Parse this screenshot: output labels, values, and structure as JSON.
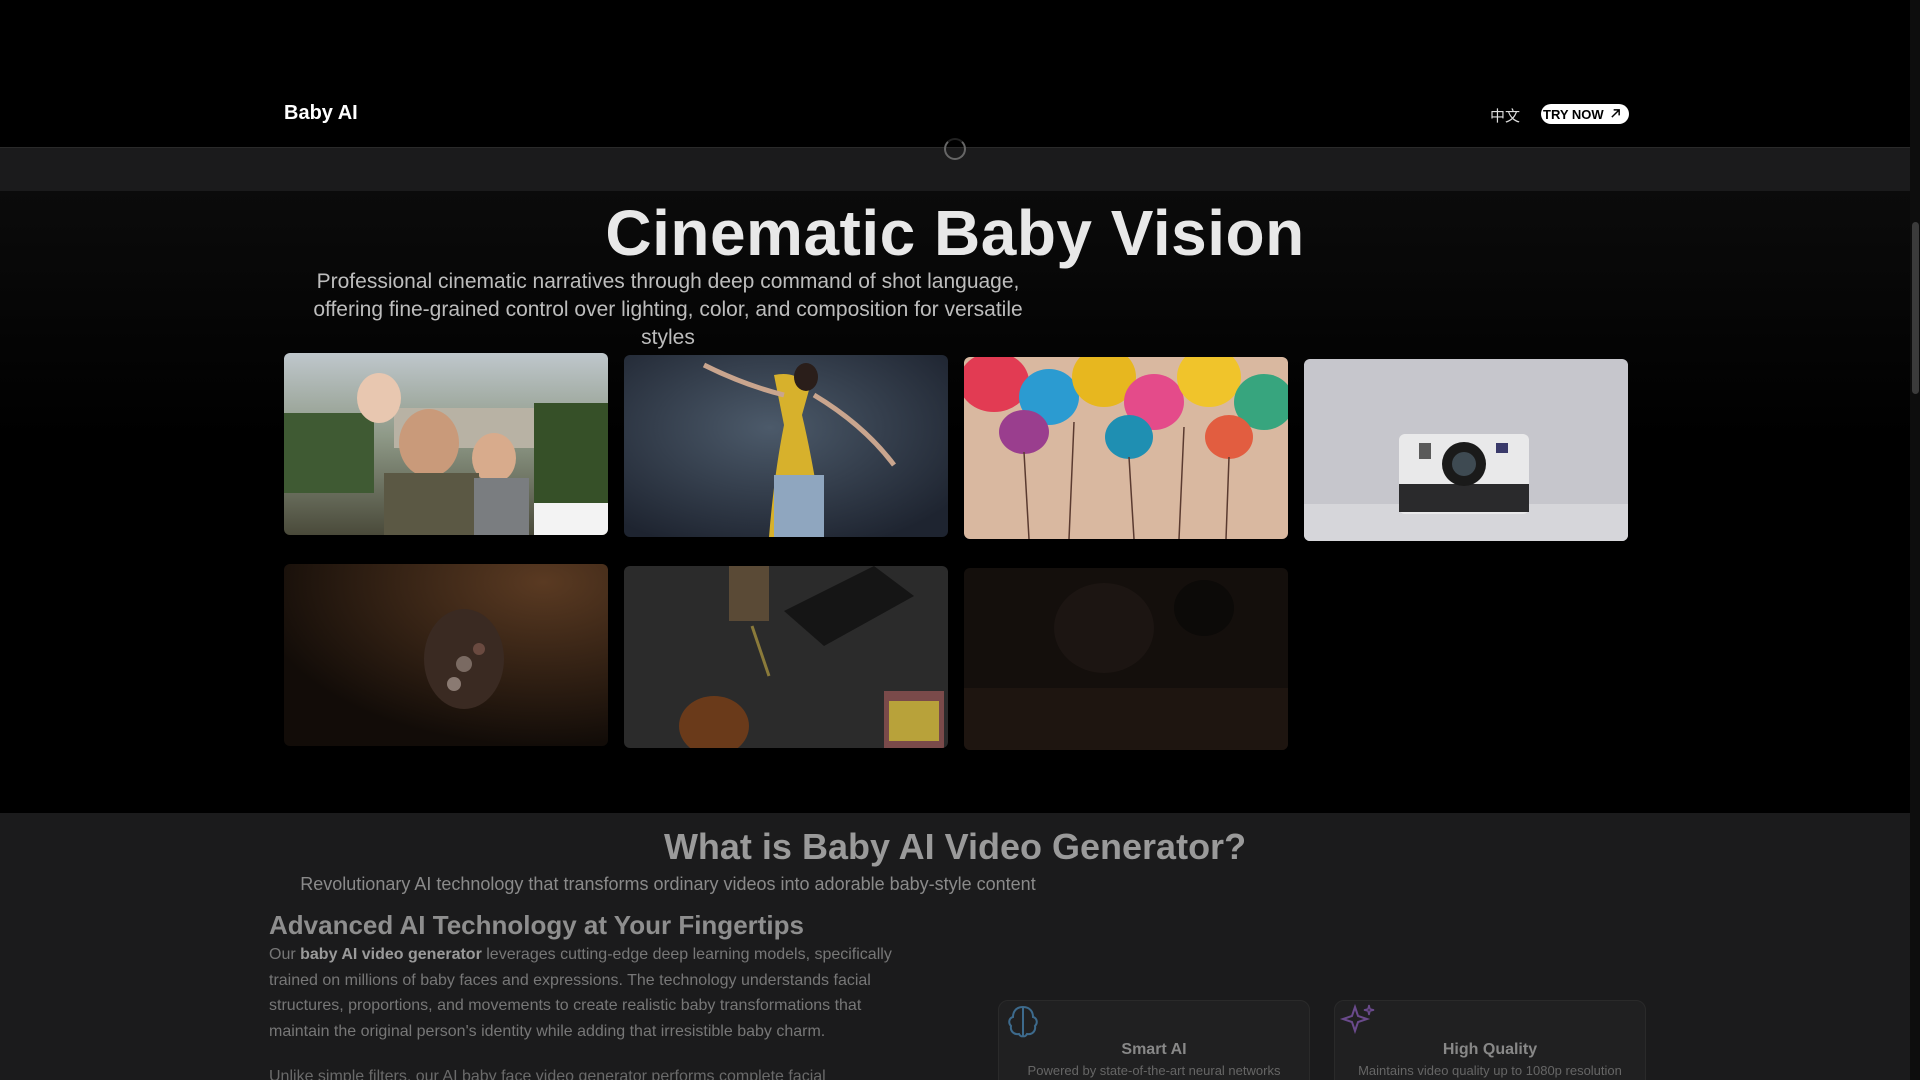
{
  "header": {
    "logo": "Baby AI",
    "lang_switch": "中文",
    "try_button": "TRY NOW"
  },
  "hero": {
    "title": "Cinematic Baby Vision",
    "subtitle": "Professional cinematic narratives through deep command of shot language, offering fine-grained control over lighting, color, and composition for versatile styles"
  },
  "gallery": [
    {
      "name": "family-photo"
    },
    {
      "name": "dancer-photo"
    },
    {
      "name": "balloons-photo"
    },
    {
      "name": "camera-photo"
    },
    {
      "name": "flowers-photo"
    },
    {
      "name": "desk-photo"
    },
    {
      "name": "dark-photo"
    }
  ],
  "section2": {
    "title": "What is Baby AI Video Generator?",
    "subtitle": "Revolutionary AI technology that transforms ordinary videos into adorable baby-style content",
    "heading": "Advanced AI Technology at Your Fingertips",
    "para_prefix": "Our ",
    "para_bold": "baby AI video generator",
    "para_rest": " leverages cutting-edge deep learning models, specifically trained on millions of baby faces and expressions. The technology understands facial structures, proportions, and movements to create realistic baby transformations that maintain the original person's identity while adding that irresistible baby charm.",
    "para2": "Unlike simple filters, our AI baby face video generator performs complete facial"
  },
  "features": [
    {
      "title": "Smart AI",
      "desc": "Powered by state-of-the-art neural networks",
      "icon": "brain-icon"
    },
    {
      "title": "High Quality",
      "desc": "Maintains video quality up to 1080p resolution",
      "icon": "sparkles-icon"
    }
  ]
}
